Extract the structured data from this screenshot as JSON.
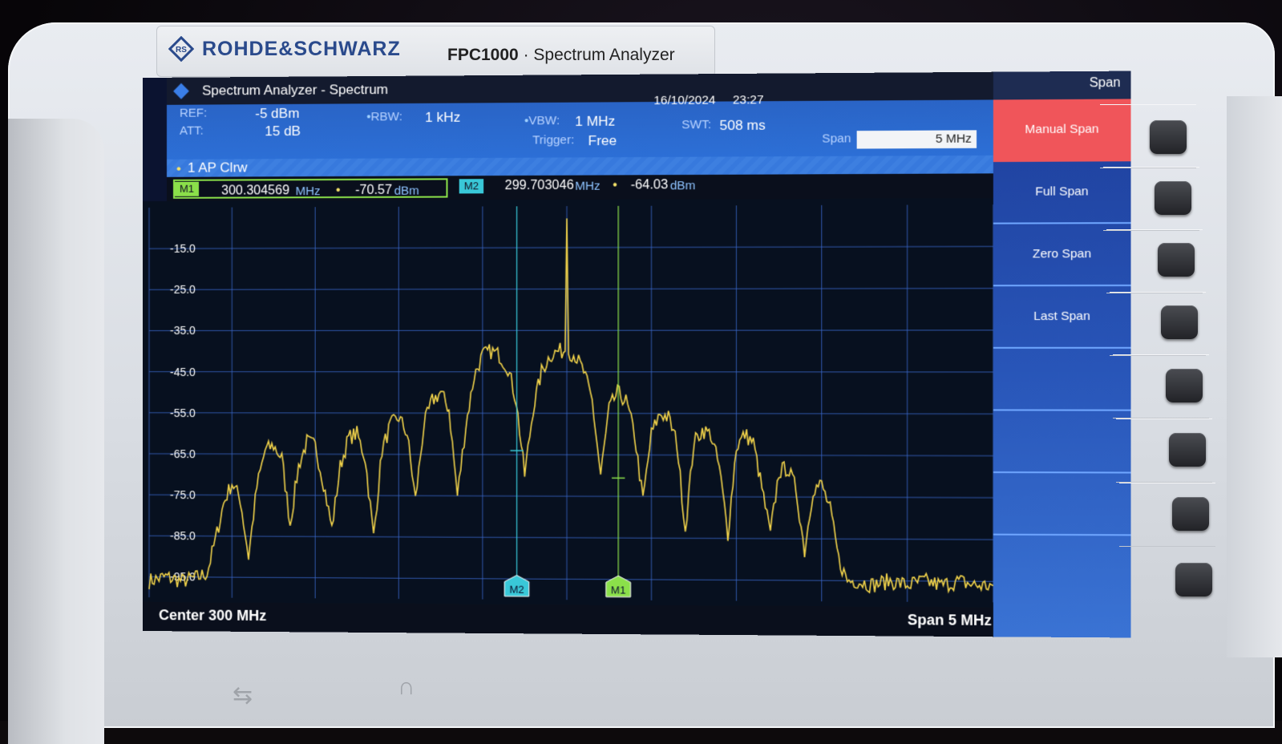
{
  "device": {
    "brand": "ROHDE&SCHWARZ",
    "model": "FPC1000",
    "product_type": "Spectrum Analyzer"
  },
  "window": {
    "title": "Spectrum Analyzer - Spectrum",
    "date": "16/10/2024",
    "time": "23:27",
    "mode": "Span"
  },
  "settings": {
    "ref_label": "REF:",
    "ref_value": "-5 dBm",
    "att_label": "ATT:",
    "att_value": "15 dB",
    "rbw_label": "RBW:",
    "rbw_value": "1 kHz",
    "vbw_label": "VBW:",
    "vbw_value": "1 MHz",
    "trigger_label": "Trigger:",
    "trigger_value": "Free",
    "swt_label": "SWT:",
    "swt_value": "508 ms",
    "span_label": "Span",
    "span_value": "5 MHz"
  },
  "trace": {
    "label": "1 AP  Clrw"
  },
  "markers": [
    {
      "id": "M1",
      "freq": "300.304569",
      "freq_unit": "MHz",
      "level": "-70.57",
      "level_unit": "dBm",
      "color": "#8be04a"
    },
    {
      "id": "M2",
      "freq": "299.703046",
      "freq_unit": "MHz",
      "level": "-64.03",
      "level_unit": "dBm",
      "color": "#39c8d8"
    }
  ],
  "footer": {
    "center": "Center 300 MHz",
    "span": "Span 5 MHz"
  },
  "softkeys": [
    "Manual Span",
    "Full Span",
    "Zero Span",
    "Last Span",
    "",
    "",
    "",
    ""
  ],
  "colors": {
    "trace": "#f0d24a",
    "grid": "#3a67c9",
    "plot_bg": "#07101f",
    "active_softkey": "#f0555a"
  },
  "chart_data": {
    "type": "line",
    "title": "",
    "xlabel": "",
    "ylabel": "",
    "x_unit": "MHz",
    "y_unit": "dBm",
    "xlim": [
      297.5,
      302.5
    ],
    "ylim": [
      -100,
      -5
    ],
    "yticks": [
      "-15.0",
      "-25.0",
      "-35.0",
      "-45.0",
      "-55.0",
      "-65.0",
      "-75.0",
      "-85.0",
      "-95.0"
    ],
    "ytick_values": [
      -15,
      -25,
      -35,
      -45,
      -55,
      -65,
      -75,
      -85,
      -95
    ],
    "grid": true,
    "series": [
      {
        "values_desc": "sinc-shaped spectrum with carrier spike",
        "x": [
          297.5,
          297.6,
          297.7,
          297.8,
          297.85,
          297.9,
          297.95,
          298.0,
          298.05,
          298.1,
          298.15,
          298.2,
          298.25,
          298.3,
          298.35,
          298.4,
          298.45,
          298.5,
          298.55,
          298.6,
          298.65,
          298.7,
          298.75,
          298.8,
          298.85,
          298.9,
          298.95,
          299.0,
          299.05,
          299.1,
          299.15,
          299.2,
          299.25,
          299.3,
          299.35,
          299.4,
          299.45,
          299.5,
          299.55,
          299.6,
          299.65,
          299.7,
          299.75,
          299.8,
          299.85,
          299.9,
          299.95,
          299.99,
          300.0,
          300.01,
          300.05,
          300.1,
          300.15,
          300.2,
          300.25,
          300.3,
          300.35,
          300.4,
          300.45,
          300.5,
          300.55,
          300.6,
          300.65,
          300.7,
          300.75,
          300.8,
          300.85,
          300.9,
          300.95,
          301.0,
          301.05,
          301.1,
          301.15,
          301.2,
          301.25,
          301.3,
          301.35,
          301.4,
          301.45,
          301.5,
          301.55,
          301.6,
          301.65,
          301.7,
          301.8,
          301.9,
          302.0,
          302.1,
          302.2,
          302.3,
          302.4,
          302.5
        ],
        "y": [
          -96,
          -95,
          -96,
          -95,
          -94,
          -86,
          -77,
          -72,
          -76,
          -90,
          -73,
          -64,
          -63,
          -66,
          -82,
          -68,
          -62,
          -63,
          -72,
          -83,
          -68,
          -61,
          -60,
          -66,
          -85,
          -64,
          -58,
          -56,
          -60,
          -76,
          -58,
          -52,
          -50,
          -54,
          -75,
          -58,
          -46,
          -41,
          -40,
          -41,
          -44,
          -52,
          -70,
          -54,
          -45,
          -41,
          -40,
          -40,
          -8,
          -40,
          -41,
          -45,
          -52,
          -70,
          -54,
          -50,
          -52,
          -60,
          -76,
          -60,
          -55,
          -56,
          -62,
          -83,
          -62,
          -59,
          -60,
          -68,
          -84,
          -63,
          -60,
          -62,
          -73,
          -84,
          -69,
          -68,
          -73,
          -88,
          -73,
          -72,
          -78,
          -90,
          -95,
          -95,
          -96,
          -95,
          -96,
          -95,
          -96,
          -95,
          -96,
          -96
        ]
      }
    ],
    "markers": [
      {
        "id": "M1",
        "x": 300.304569,
        "y": -70.57
      },
      {
        "id": "M2",
        "x": 299.703046,
        "y": -64.03
      }
    ]
  }
}
